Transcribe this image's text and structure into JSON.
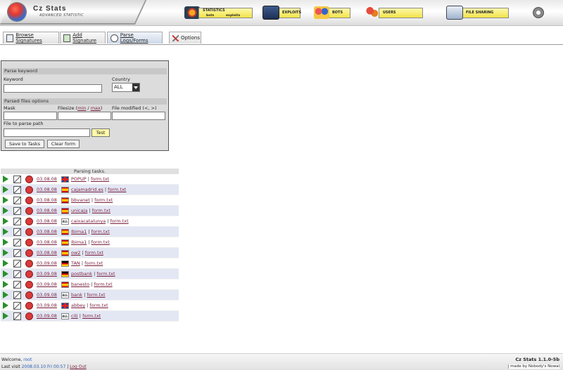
{
  "app": {
    "title": "Cz Stats",
    "subtitle": "ADVANCED STATISTIC"
  },
  "nav": {
    "statistics": {
      "label": "STATISTICS",
      "sub1": "bots",
      "sub2": "exploits"
    },
    "exploits": {
      "label": "EXPLOITS"
    },
    "bots": {
      "label": "BOTS"
    },
    "users": {
      "label": "USERS"
    },
    "file_sharing": {
      "label": "FILE SHARING"
    }
  },
  "tabs": [
    {
      "label": "Browse Signatures"
    },
    {
      "label": "Add Signature"
    },
    {
      "label": "Parse Logs/Forms"
    },
    {
      "label": "Options"
    }
  ],
  "form": {
    "section_keyword": "Parse keyword",
    "keyword_label": "Keyword",
    "keyword_value": "",
    "country_label": "Country",
    "country_value": "ALL",
    "section_files": "Parsed files options",
    "mask_label": "Mask",
    "filesize_label": "Filesize (",
    "filesize_min": "min",
    "filesize_sep": " / ",
    "filesize_max": "max",
    "filesize_end": ")",
    "modified_label": "File modified (<, >)",
    "path_label": "File to parse path",
    "test_button": "Test",
    "save_button": "Save to Tasks",
    "clear_button": "Clear form"
  },
  "tasks": {
    "header": "Parsing tasks.",
    "rows": [
      {
        "date": "03.08.08",
        "flag": "gb",
        "name": "POPUP",
        "file": "form.txt"
      },
      {
        "date": "03.08.08",
        "flag": "es",
        "name": "cajamadrid.es",
        "file": "form.txt"
      },
      {
        "date": "03.08.08",
        "flag": "es",
        "name": "bbvanet",
        "file": "form.txt"
      },
      {
        "date": "03.08.08",
        "flag": "es",
        "name": "unicaja",
        "file": "form.txt"
      },
      {
        "date": "03.08.08",
        "flag": "all",
        "name": "caixacatalunya",
        "file": "form.txt"
      },
      {
        "date": "03.08.08",
        "flag": "es",
        "name": "Ibima1",
        "file": "form.txt"
      },
      {
        "date": "03.08.08",
        "flag": "es",
        "name": "Ibima1",
        "file": "form.txt"
      },
      {
        "date": "03.08.08",
        "flag": "es",
        "name": "ow2",
        "file": "form.txt"
      },
      {
        "date": "03.09.08",
        "flag": "de",
        "name": "TAN",
        "file": "form.txt"
      },
      {
        "date": "03.09.08",
        "flag": "de",
        "name": "postbank",
        "file": "form.txt"
      },
      {
        "date": "03.09.08",
        "flag": "es",
        "name": "banesto",
        "file": "form.txt"
      },
      {
        "date": "03.09.08",
        "flag": "all",
        "name": "bank",
        "file": "form.txt"
      },
      {
        "date": "03.09.08",
        "flag": "gb",
        "name": "abbey",
        "file": "form.txt"
      },
      {
        "date": "03.09.08",
        "flag": "all",
        "name": "citi",
        "file": "form.txt"
      }
    ]
  },
  "footer": {
    "welcome_prefix": "Welcome, ",
    "username": "root",
    "last_visit_prefix": "Last visit ",
    "last_visit": "2008.03.10 Fri 00:57",
    "separator": " | ",
    "logout": "Log Out",
    "version": "Cz Stats 1.1.0-5b",
    "made_by": "made by Nobody's Nowai"
  },
  "colors": {
    "nav_label_bg": "#f2e34a",
    "active_tab": "#cdd8e8",
    "alt_row": "#e3e7f4",
    "link": "#7a1f3d",
    "play": "#2b8f2b",
    "delete": "#d83a3a"
  },
  "icons": [
    "statistics-icon",
    "exploits-icon",
    "bots-icon",
    "users-icon",
    "file-sharing-icon",
    "settings-icon",
    "play-icon",
    "edit-icon",
    "delete-icon"
  ]
}
